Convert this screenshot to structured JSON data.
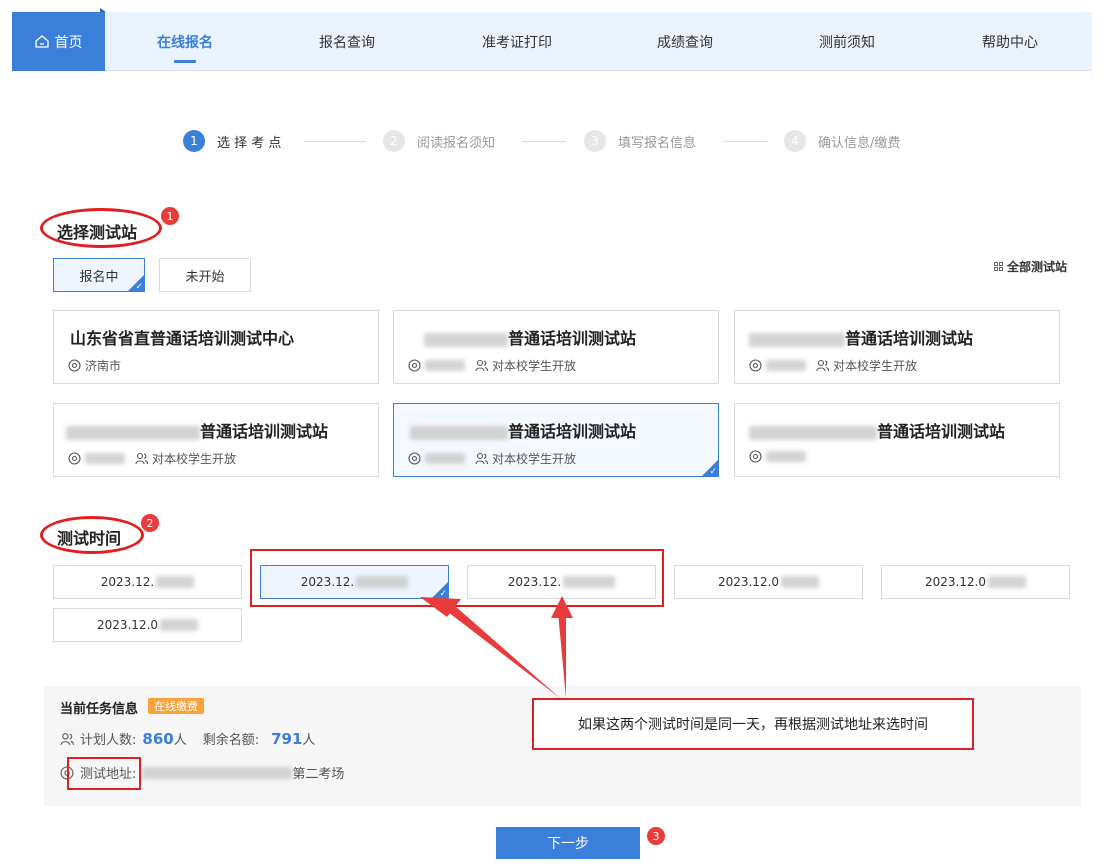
{
  "nav": {
    "home": "首页",
    "items": [
      "在线报名",
      "报名查询",
      "准考证打印",
      "成绩查询",
      "测前须知",
      "帮助中心"
    ],
    "active_index": 0
  },
  "steps": [
    {
      "num": "1",
      "label": "选 择 考 点"
    },
    {
      "num": "2",
      "label": "阅读报名须知"
    },
    {
      "num": "3",
      "label": "填写报名信息"
    },
    {
      "num": "4",
      "label": "确认信息/缴费"
    }
  ],
  "station_section": {
    "title": "选择测试站",
    "badge": "1",
    "tabs": [
      "报名中",
      "未开始"
    ],
    "all_label": "全部测试站"
  },
  "stations": [
    {
      "name": "山东省省直普通话培训测试中心",
      "location": "济南市",
      "scope": ""
    },
    {
      "name": "普通话培训测试站",
      "location": "",
      "scope": "对本校学生开放"
    },
    {
      "name": "普通话培训测试站",
      "location": "",
      "scope": "对本校学生开放"
    },
    {
      "name": "普通话培训测试站",
      "location": "",
      "scope": "对本校学生开放"
    },
    {
      "name": "普通话培训测试站",
      "location": "",
      "scope": "对本校学生开放"
    },
    {
      "name": "普通话培训测试站",
      "location": "",
      "scope": ""
    }
  ],
  "time_section": {
    "title": "测试时间",
    "badge": "2",
    "slots": [
      "2023.12.",
      "2023.12.",
      "2023.12.",
      "2023.12.0",
      "2023.12.0",
      "2023.12.0"
    ]
  },
  "task": {
    "title": "当前任务信息",
    "tag": "在线缴费",
    "plan_label": "计划人数:",
    "plan_value": "860",
    "unit": "人",
    "remain_label": "剩余名额:",
    "remain_value": "791",
    "address_label": "测试地址:",
    "address_value": "第二考场"
  },
  "callout": "如果这两个测试时间是同一天，再根据测试地址来选时间",
  "next_button": "下一步",
  "next_badge": "3",
  "colors": {
    "primary": "#3a7fd9",
    "annotation": "#e02020",
    "tag": "#f7a23b"
  }
}
